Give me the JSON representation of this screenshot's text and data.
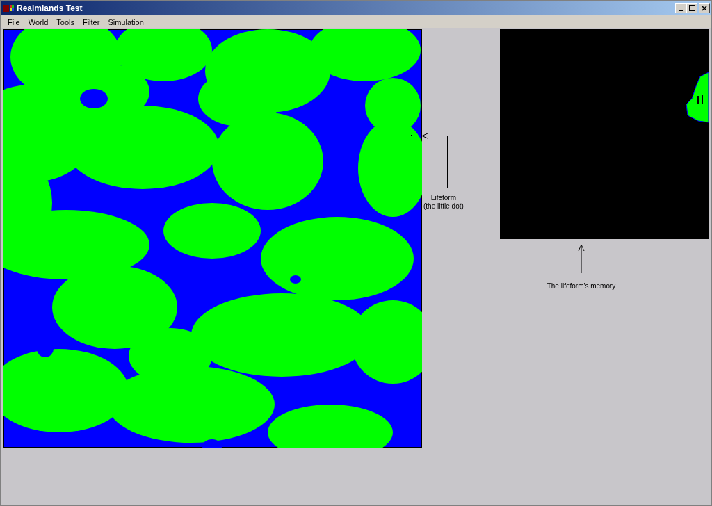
{
  "window": {
    "title": "Realmlands Test"
  },
  "menu": [
    "File",
    "World",
    "Tools",
    "Filter",
    "Simulation"
  ],
  "annotations": [
    {
      "kind": "left",
      "lines": [
        "Lifeform",
        "(the little dot)"
      ]
    },
    {
      "kind": "up",
      "lines": [
        "The lifeform's memory"
      ]
    }
  ]
}
